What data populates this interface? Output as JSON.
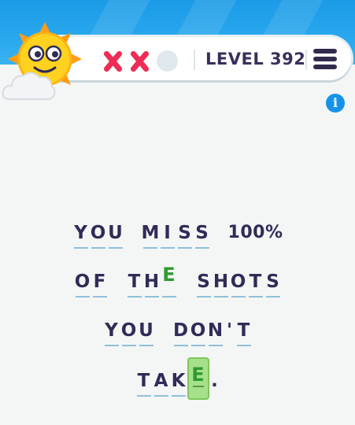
{
  "header": {
    "lives": [
      {
        "state": "used",
        "icon": "x-icon"
      },
      {
        "state": "used",
        "icon": "x-icon"
      },
      {
        "state": "left",
        "icon": "circle-icon"
      }
    ],
    "level_label": "LEVEL 392",
    "menu_icon": "hamburger-menu-icon",
    "info_label": "i"
  },
  "colors": {
    "sky": "#1b9be6",
    "text": "#2f2c57",
    "mistake": "#ee2c55",
    "guess": "#2e9a2e",
    "active_tile": "#a7e08a",
    "info": "#1693e8"
  },
  "puzzle": {
    "lines": [
      [
        {
          "type": "word",
          "letters": [
            "Y",
            "O",
            "U"
          ],
          "blanks": [
            true,
            true,
            true
          ]
        },
        {
          "type": "word",
          "letters": [
            "M",
            "I",
            "S",
            "S"
          ],
          "blanks": [
            true,
            true,
            true,
            true
          ]
        },
        {
          "type": "text",
          "value": "100%"
        }
      ],
      [
        {
          "type": "word",
          "letters": [
            "O",
            "F"
          ],
          "blanks": [
            true,
            true
          ]
        },
        {
          "type": "word",
          "letters": [
            "T",
            "H",
            "E"
          ],
          "blanks": [
            true,
            true,
            true
          ],
          "guess_index": 2
        },
        {
          "type": "word",
          "letters": [
            "S",
            "H",
            "O",
            "T",
            "S"
          ],
          "blanks": [
            true,
            true,
            true,
            true,
            true
          ]
        }
      ],
      [
        {
          "type": "word",
          "letters": [
            "Y",
            "O",
            "U"
          ],
          "blanks": [
            true,
            true,
            true
          ]
        },
        {
          "type": "word",
          "letters": [
            "D",
            "O",
            "N",
            "'",
            "T"
          ],
          "blanks": [
            true,
            true,
            true,
            false,
            true
          ]
        }
      ],
      [
        {
          "type": "word",
          "letters": [
            "T",
            "A",
            "K",
            "E",
            "."
          ],
          "blanks": [
            true,
            true,
            true,
            true,
            false
          ],
          "active_index": 3
        }
      ]
    ]
  }
}
